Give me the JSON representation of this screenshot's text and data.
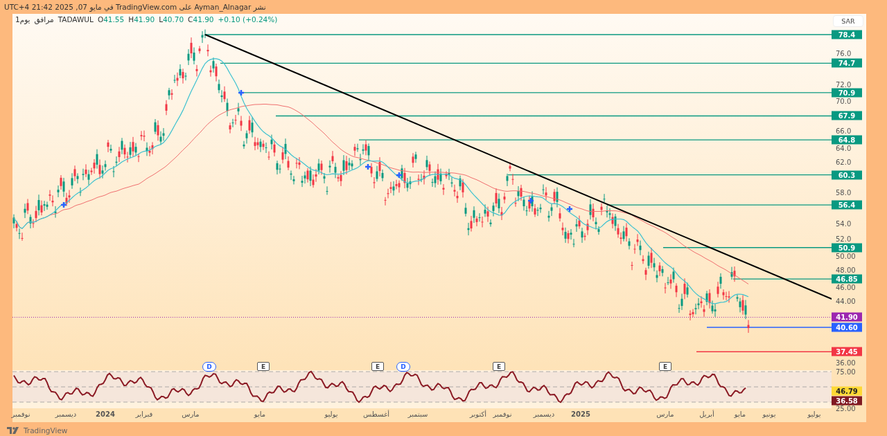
{
  "header": {
    "text": "نشر Ayman_Alnagar على TradingView.com في مايو 07, 2025 21:42 UTC+4"
  },
  "legend": {
    "interval": "1يوم",
    "name": "مرافق",
    "exchange": "TADAWUL",
    "values": [
      "C41.90",
      "L40.70",
      "H41.90",
      "O41.55"
    ],
    "change": "+0.10 (+0.24%)"
  },
  "currency": "SAR",
  "price_axis": {
    "ticks": [
      "76.0",
      "72.0",
      "70.0",
      "66.0",
      "64.0",
      "62.0",
      "58.0",
      "54.0",
      "52.0",
      "50.00",
      "48.00",
      "46.00",
      "44.00",
      "36.00"
    ],
    "levels": [
      {
        "kind": "level",
        "label": "78.4",
        "color": "#089981"
      },
      {
        "kind": "level",
        "label": "74.7",
        "color": "#089981"
      },
      {
        "kind": "level",
        "label": "70.9",
        "color": "#089981"
      },
      {
        "kind": "level",
        "label": "67.9",
        "color": "#089981"
      },
      {
        "kind": "level",
        "label": "64.8",
        "color": "#089981"
      },
      {
        "kind": "level",
        "label": "60.3",
        "color": "#089981"
      },
      {
        "kind": "level",
        "label": "56.4",
        "color": "#089981"
      },
      {
        "kind": "level",
        "label": "50.9",
        "color": "#089981"
      },
      {
        "kind": "level",
        "label": "46.85",
        "color": "#089981"
      },
      {
        "kind": "price",
        "label": "41.90",
        "color": "#9c27b0"
      },
      {
        "kind": "level",
        "label": "40.60",
        "color": "#2962ff"
      },
      {
        "kind": "level",
        "label": "37.45",
        "color": "#f23645"
      }
    ]
  },
  "events": [
    {
      "kind": "earnings",
      "label": "E"
    },
    {
      "kind": "earnings",
      "label": "E"
    },
    {
      "kind": "dividend",
      "label": "D"
    },
    {
      "kind": "earnings",
      "label": "E"
    },
    {
      "kind": "earnings",
      "label": "E"
    },
    {
      "kind": "dividend",
      "label": "D"
    }
  ],
  "rsi": {
    "ticks": [
      "75.00",
      "25.00"
    ],
    "readings": [
      {
        "label": "46.79",
        "color": "#fdd835"
      },
      {
        "label": "36.58",
        "color": "#801922"
      }
    ]
  },
  "time_axis": [
    {
      "label": "يوليو",
      "bold": false
    },
    {
      "label": "يونيو",
      "bold": false
    },
    {
      "label": "مايو",
      "bold": false
    },
    {
      "label": "أبريل",
      "bold": false
    },
    {
      "label": "مارس",
      "bold": false
    },
    {
      "label": "2025",
      "bold": true
    },
    {
      "label": "ديسمبر",
      "bold": false
    },
    {
      "label": "نوفمبر",
      "bold": false
    },
    {
      "label": "أكتوبر",
      "bold": false
    },
    {
      "label": "سبتمبر",
      "bold": false
    },
    {
      "label": "أغسطس",
      "bold": false
    },
    {
      "label": "يوليو",
      "bold": false
    },
    {
      "label": "مايو",
      "bold": false
    },
    {
      "label": "مارس",
      "bold": false
    },
    {
      "label": "فبراير",
      "bold": false
    },
    {
      "label": "2024",
      "bold": true
    },
    {
      "label": "ديسمبر",
      "bold": false
    },
    {
      "label": "نوفمبر",
      "bold": false
    }
  ],
  "footer": {
    "brand": "TradingView"
  }
}
